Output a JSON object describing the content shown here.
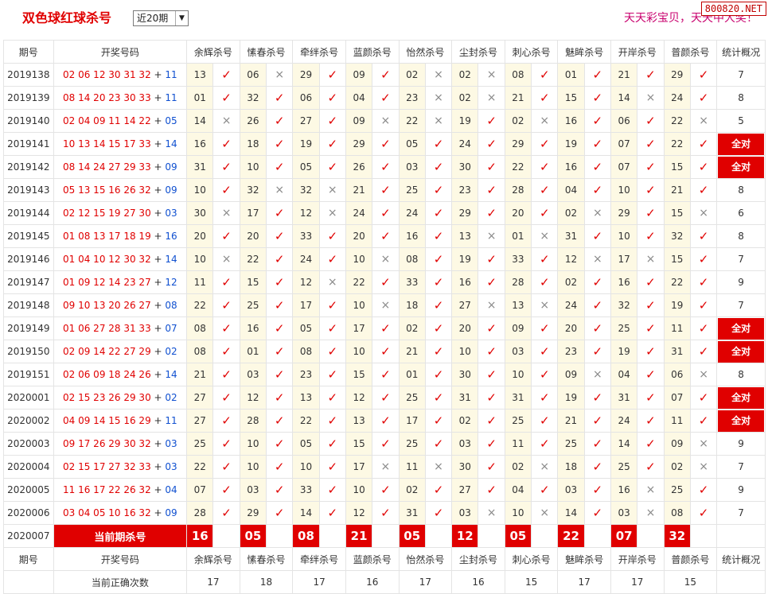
{
  "header": {
    "title": "双色球红球杀号",
    "range_selected": "近20期",
    "slogan": "天天彩宝贝，天天中大奖！",
    "site_badge": "800820.NET"
  },
  "table": {
    "columns": [
      "期号",
      "开奖号码",
      "余辉杀号",
      "愫春杀号",
      "牵绊杀号",
      "蓝颜杀号",
      "怡然杀号",
      "尘封杀号",
      "刺心杀号",
      "魅眸杀号",
      "开岸杀号",
      "普颜杀号",
      "统计概况"
    ],
    "rows": [
      {
        "period": "2019138",
        "reds": "02 06 12 30 31 32",
        "blue": "11",
        "picks": [
          "13",
          "06",
          "29",
          "09",
          "02",
          "02",
          "08",
          "01",
          "21",
          "29"
        ],
        "ok": [
          1,
          0,
          1,
          1,
          0,
          0,
          1,
          1,
          1,
          1
        ],
        "stat": "7"
      },
      {
        "period": "2019139",
        "reds": "08 14 20 23 30 33",
        "blue": "11",
        "picks": [
          "01",
          "32",
          "06",
          "04",
          "23",
          "02",
          "21",
          "15",
          "14",
          "24"
        ],
        "ok": [
          1,
          1,
          1,
          1,
          0,
          0,
          1,
          1,
          0,
          1
        ],
        "stat": "8"
      },
      {
        "period": "2019140",
        "reds": "02 04 09 11 14 22",
        "blue": "05",
        "picks": [
          "14",
          "26",
          "27",
          "09",
          "22",
          "19",
          "02",
          "16",
          "06",
          "22"
        ],
        "ok": [
          0,
          1,
          1,
          0,
          0,
          1,
          0,
          1,
          1,
          0
        ],
        "stat": "5"
      },
      {
        "period": "2019141",
        "reds": "10 13 14 15 17 33",
        "blue": "14",
        "picks": [
          "16",
          "18",
          "19",
          "29",
          "05",
          "24",
          "29",
          "19",
          "07",
          "22"
        ],
        "ok": [
          1,
          1,
          1,
          1,
          1,
          1,
          1,
          1,
          1,
          1
        ],
        "stat": "全对"
      },
      {
        "period": "2019142",
        "reds": "08 14 24 27 29 33",
        "blue": "09",
        "picks": [
          "31",
          "10",
          "05",
          "26",
          "03",
          "30",
          "22",
          "16",
          "07",
          "15"
        ],
        "ok": [
          1,
          1,
          1,
          1,
          1,
          1,
          1,
          1,
          1,
          1
        ],
        "stat": "全对"
      },
      {
        "period": "2019143",
        "reds": "05 13 15 16 26 32",
        "blue": "09",
        "picks": [
          "10",
          "32",
          "32",
          "21",
          "25",
          "23",
          "28",
          "04",
          "10",
          "21"
        ],
        "ok": [
          1,
          0,
          0,
          1,
          1,
          1,
          1,
          1,
          1,
          1
        ],
        "stat": "8"
      },
      {
        "period": "2019144",
        "reds": "02 12 15 19 27 30",
        "blue": "03",
        "picks": [
          "30",
          "17",
          "12",
          "24",
          "24",
          "29",
          "20",
          "02",
          "29",
          "15"
        ],
        "ok": [
          0,
          1,
          0,
          1,
          1,
          1,
          1,
          0,
          1,
          0
        ],
        "stat": "6"
      },
      {
        "period": "2019145",
        "reds": "01 08 13 17 18 19",
        "blue": "16",
        "picks": [
          "20",
          "20",
          "33",
          "20",
          "16",
          "13",
          "01",
          "31",
          "10",
          "32"
        ],
        "ok": [
          1,
          1,
          1,
          1,
          1,
          0,
          0,
          1,
          1,
          1
        ],
        "stat": "8"
      },
      {
        "period": "2019146",
        "reds": "01 04 10 12 30 32",
        "blue": "14",
        "picks": [
          "10",
          "22",
          "24",
          "10",
          "08",
          "19",
          "33",
          "12",
          "17",
          "15"
        ],
        "ok": [
          0,
          1,
          1,
          0,
          1,
          1,
          1,
          0,
          0,
          1
        ],
        "stat": "7"
      },
      {
        "period": "2019147",
        "reds": "01 09 12 14 23 27",
        "blue": "12",
        "picks": [
          "11",
          "15",
          "12",
          "22",
          "33",
          "16",
          "28",
          "02",
          "16",
          "22"
        ],
        "ok": [
          1,
          1,
          0,
          1,
          1,
          1,
          1,
          1,
          1,
          1
        ],
        "stat": "9"
      },
      {
        "period": "2019148",
        "reds": "09 10 13 20 26 27",
        "blue": "08",
        "picks": [
          "22",
          "25",
          "17",
          "10",
          "18",
          "27",
          "13",
          "24",
          "32",
          "19"
        ],
        "ok": [
          1,
          1,
          1,
          0,
          1,
          0,
          0,
          1,
          1,
          1
        ],
        "stat": "7"
      },
      {
        "period": "2019149",
        "reds": "01 06 27 28 31 33",
        "blue": "07",
        "picks": [
          "08",
          "16",
          "05",
          "17",
          "02",
          "20",
          "09",
          "20",
          "25",
          "11"
        ],
        "ok": [
          1,
          1,
          1,
          1,
          1,
          1,
          1,
          1,
          1,
          1
        ],
        "stat": "全对"
      },
      {
        "period": "2019150",
        "reds": "02 09 14 22 27 29",
        "blue": "02",
        "picks": [
          "08",
          "01",
          "08",
          "10",
          "21",
          "10",
          "03",
          "23",
          "19",
          "31"
        ],
        "ok": [
          1,
          1,
          1,
          1,
          1,
          1,
          1,
          1,
          1,
          1
        ],
        "stat": "全对"
      },
      {
        "period": "2019151",
        "reds": "02 06 09 18 24 26",
        "blue": "14",
        "picks": [
          "21",
          "03",
          "23",
          "15",
          "01",
          "30",
          "10",
          "09",
          "04",
          "06"
        ],
        "ok": [
          1,
          1,
          1,
          1,
          1,
          1,
          1,
          0,
          1,
          0
        ],
        "stat": "8"
      },
      {
        "period": "2020001",
        "reds": "02 15 23 26 29 30",
        "blue": "02",
        "picks": [
          "27",
          "12",
          "13",
          "12",
          "25",
          "31",
          "31",
          "19",
          "31",
          "07"
        ],
        "ok": [
          1,
          1,
          1,
          1,
          1,
          1,
          1,
          1,
          1,
          1
        ],
        "stat": "全对"
      },
      {
        "period": "2020002",
        "reds": "04 09 14 15 16 29",
        "blue": "11",
        "picks": [
          "27",
          "28",
          "22",
          "13",
          "17",
          "02",
          "25",
          "21",
          "24",
          "11"
        ],
        "ok": [
          1,
          1,
          1,
          1,
          1,
          1,
          1,
          1,
          1,
          1
        ],
        "stat": "全对"
      },
      {
        "period": "2020003",
        "reds": "09 17 26 29 30 32",
        "blue": "03",
        "picks": [
          "25",
          "10",
          "05",
          "15",
          "25",
          "03",
          "11",
          "25",
          "14",
          "09"
        ],
        "ok": [
          1,
          1,
          1,
          1,
          1,
          1,
          1,
          1,
          1,
          0
        ],
        "stat": "9"
      },
      {
        "period": "2020004",
        "reds": "02 15 17 27 32 33",
        "blue": "03",
        "picks": [
          "22",
          "10",
          "10",
          "17",
          "11",
          "30",
          "02",
          "18",
          "25",
          "02"
        ],
        "ok": [
          1,
          1,
          1,
          0,
          0,
          1,
          0,
          1,
          1,
          0
        ],
        "stat": "7"
      },
      {
        "period": "2020005",
        "reds": "11 16 17 22 26 32",
        "blue": "04",
        "picks": [
          "07",
          "03",
          "33",
          "10",
          "02",
          "27",
          "04",
          "03",
          "16",
          "25"
        ],
        "ok": [
          1,
          1,
          1,
          1,
          1,
          1,
          1,
          1,
          0,
          1
        ],
        "stat": "9"
      },
      {
        "period": "2020006",
        "reds": "03 04 05 10 16 32",
        "blue": "09",
        "picks": [
          "28",
          "29",
          "14",
          "12",
          "31",
          "03",
          "10",
          "14",
          "03",
          "08"
        ],
        "ok": [
          1,
          1,
          1,
          1,
          1,
          0,
          0,
          1,
          0,
          1
        ],
        "stat": "7"
      }
    ],
    "current": {
      "period": "2020007",
      "label": "当前期杀号",
      "picks": [
        "16",
        "05",
        "08",
        "21",
        "05",
        "12",
        "05",
        "22",
        "07",
        "32"
      ]
    },
    "footer_count_label": "当前正确次数",
    "footer_counts": [
      "17",
      "18",
      "17",
      "16",
      "17",
      "16",
      "15",
      "17",
      "17",
      "15"
    ]
  },
  "symbols": {
    "ok": "✓",
    "no": "×",
    "plus": "+"
  },
  "colors": {
    "red": "#e00000",
    "blue": "#1050d0",
    "pick_bg": "#fdf9e4",
    "slogan": "#c8006e"
  }
}
